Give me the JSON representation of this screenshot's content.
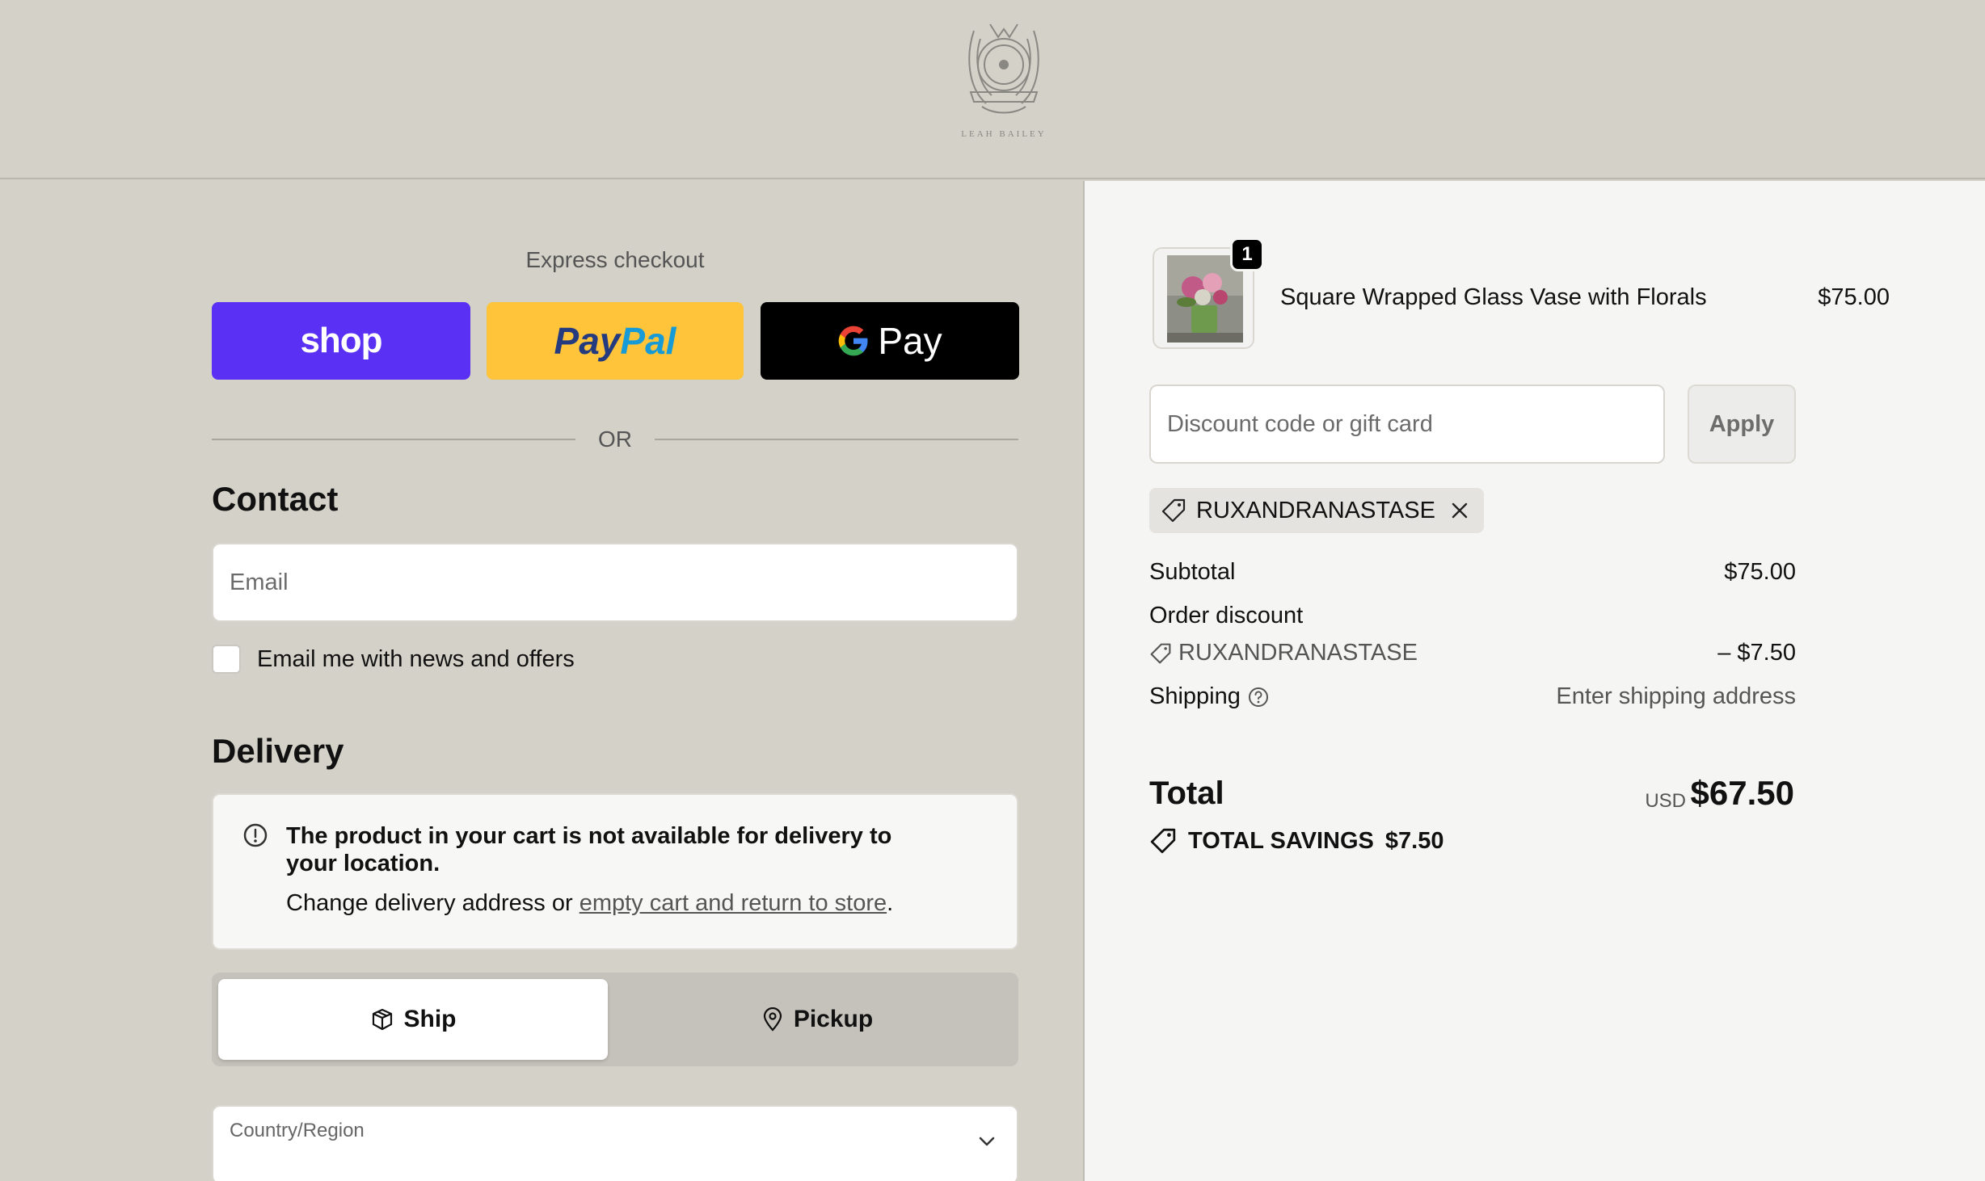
{
  "brand": {
    "logo_icon": "crest-logo-icon",
    "logo_text": "LEAH BAILEY"
  },
  "express": {
    "title": "Express checkout",
    "shop_label": "shop",
    "paypal_label_1": "Pay",
    "paypal_label_2": "Pal",
    "gpay_label": "Pay",
    "or_label": "OR"
  },
  "contact": {
    "title": "Contact",
    "email_placeholder": "Email",
    "newsletter_label": "Email me with news and offers"
  },
  "delivery": {
    "title": "Delivery",
    "alert_title": "The product in your cart is not available for delivery to your location.",
    "alert_body_prefix": "Change delivery address or ",
    "alert_link": "empty cart and return to store",
    "alert_body_suffix": ".",
    "ship_label": "Ship",
    "pickup_label": "Pickup",
    "country_label": "Country/Region"
  },
  "cart": {
    "item_name": "Square Wrapped Glass Vase with Florals",
    "item_price": "$75.00",
    "item_qty": "1",
    "discount_placeholder": "Discount code or gift card",
    "apply_label": "Apply",
    "applied_code": "RUXANDRANASTASE"
  },
  "summary": {
    "subtotal_label": "Subtotal",
    "subtotal_value": "$75.00",
    "discount_label": "Order discount",
    "discount_code": "RUXANDRANASTASE",
    "discount_value": "– $7.50",
    "shipping_label": "Shipping",
    "shipping_value": "Enter shipping address",
    "total_label": "Total",
    "total_currency": "USD",
    "total_value": "$67.50",
    "savings_label": "TOTAL SAVINGS",
    "savings_value": "$7.50"
  },
  "colors": {
    "shop_purple": "#5a31f4",
    "paypal_yellow": "#ffc439",
    "gpay_black": "#000000",
    "page_bg": "#d3d1c8",
    "summary_bg": "#f5f5f4"
  }
}
